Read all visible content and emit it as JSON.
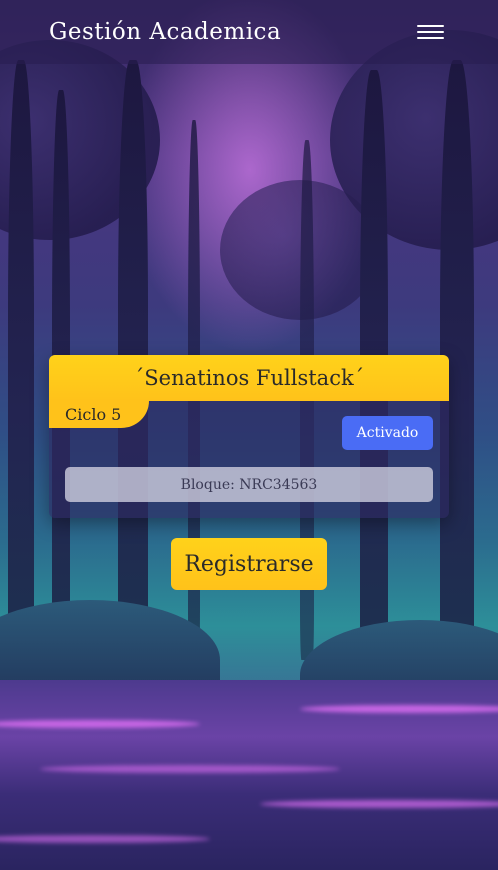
{
  "header": {
    "brand": "Gestión Academica",
    "menu_icon": "hamburger-menu-icon"
  },
  "card": {
    "title": "´Senatinos Fullstack´",
    "cycle": "Ciclo 5",
    "status": "Activado",
    "block": "Bloque: NRC34563"
  },
  "actions": {
    "register_label": "Registrarse"
  },
  "colors": {
    "accent_yellow": "#ffc21a",
    "status_blue": "#4a6cf5",
    "header_bg": "#281e50"
  }
}
